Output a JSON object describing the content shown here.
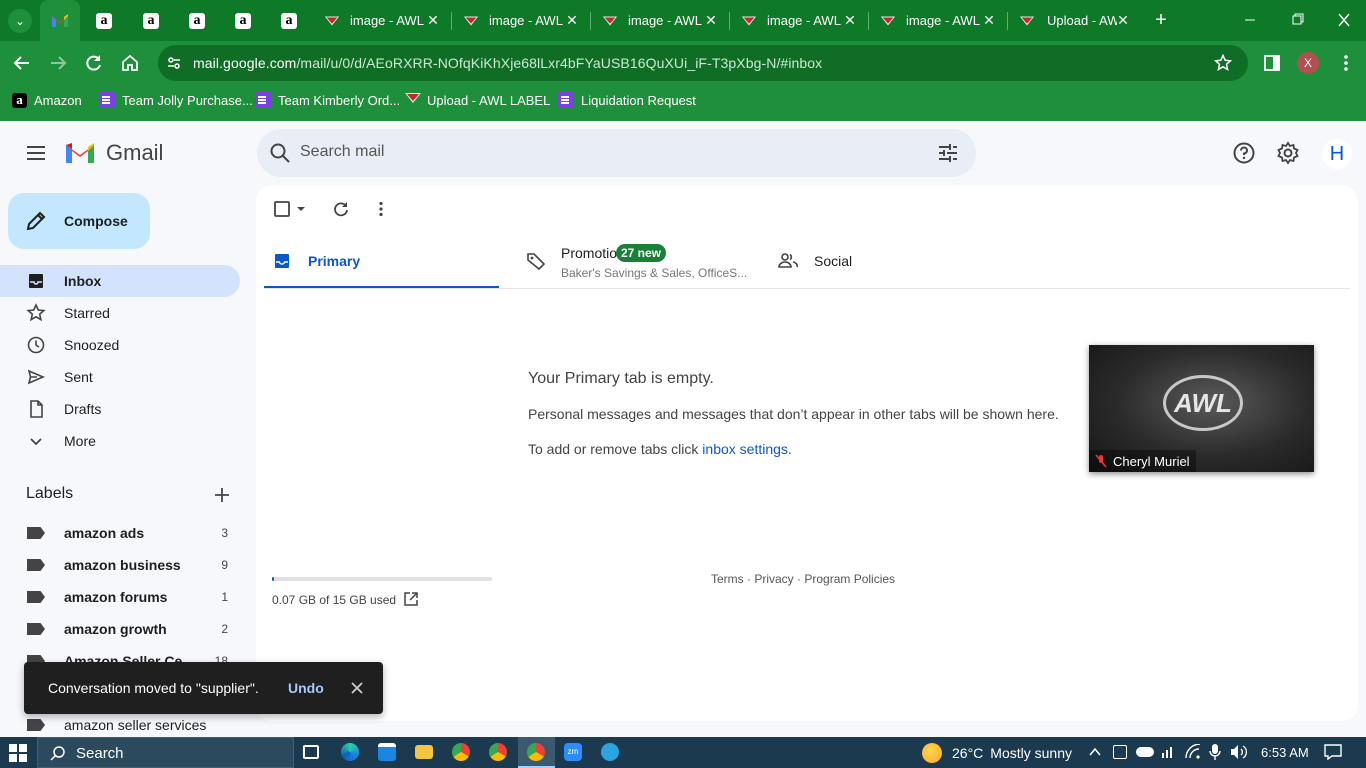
{
  "browser": {
    "tabs": [
      {
        "type": "gmail",
        "title": ""
      },
      {
        "type": "amazon",
        "title": ""
      },
      {
        "type": "amazon",
        "title": ""
      },
      {
        "type": "amazon",
        "title": ""
      },
      {
        "type": "amazon",
        "title": ""
      },
      {
        "type": "amazon",
        "title": ""
      },
      {
        "type": "awl",
        "title": "image - AWL"
      },
      {
        "type": "awl",
        "title": "image - AWL"
      },
      {
        "type": "awl",
        "title": "image - AWL"
      },
      {
        "type": "awl",
        "title": "image - AWL"
      },
      {
        "type": "awl",
        "title": "image - AWL"
      },
      {
        "type": "awl",
        "title": "Upload - AW"
      }
    ],
    "url_host": "mail.google.com",
    "url_path": "/mail/u/0/d/AEoRXRR-NOfqKiKhXje68lLxr4bFYaUSB16QuXUi_iF-T3pXbg-N/#inbox",
    "profile_initial": "X",
    "bookmarks": [
      {
        "icon": "amazon-icon",
        "label": "Amazon"
      },
      {
        "icon": "sheet-icon",
        "label": "Team Jolly Purchase..."
      },
      {
        "icon": "sheet-icon",
        "label": "Team Kimberly Ord..."
      },
      {
        "icon": "awl-icon",
        "label": "Upload - AWL LABEL"
      },
      {
        "icon": "sheet-icon",
        "label": "Liquidation Request"
      }
    ]
  },
  "gmail": {
    "logo_text": "Gmail",
    "search_placeholder": "Search mail",
    "account_initial": "H",
    "compose_label": "Compose",
    "nav": [
      {
        "icon": "inbox-icon",
        "label": "Inbox",
        "active": true
      },
      {
        "icon": "star-icon",
        "label": "Starred"
      },
      {
        "icon": "clock-icon",
        "label": "Snoozed"
      },
      {
        "icon": "send-icon",
        "label": "Sent"
      },
      {
        "icon": "draft-icon",
        "label": "Drafts"
      },
      {
        "icon": "chevron-down-icon",
        "label": "More"
      }
    ],
    "labels_heading": "Labels",
    "labels": [
      {
        "name": "amazon ads",
        "count": "3"
      },
      {
        "name": "amazon business",
        "count": "9"
      },
      {
        "name": "amazon forums",
        "count": "1"
      },
      {
        "name": "amazon growth",
        "count": "2"
      },
      {
        "name": "Amazon Seller Ce...",
        "count": "18"
      },
      {
        "name": "amazon seller services",
        "count": ""
      }
    ],
    "tabs": {
      "primary": "Primary",
      "promotions": "Promotions",
      "promotions_badge": "27 new",
      "promotions_snippet": "Baker's Savings & Sales, OfficeS...",
      "social": "Social"
    },
    "empty": {
      "title": "Your Primary tab is empty.",
      "line1": "Personal messages and messages that don’t appear in other tabs will be shown here.",
      "line2_prefix": "To add or remove tabs click ",
      "line2_link": "inbox settings",
      "line2_suffix": "."
    },
    "storage": {
      "text": "0.07 GB of 15 GB used",
      "fraction": 0.005
    },
    "footer": {
      "terms": "Terms",
      "privacy": "Privacy",
      "policies": "Program Policies",
      "dot": " · "
    },
    "video": {
      "name": "Cheryl Muriel",
      "logo_text": "AWL"
    },
    "snackbar": {
      "message": "Conversation moved to \"supplier\".",
      "action": "Undo"
    }
  },
  "taskbar": {
    "search": "Search",
    "weather_temp": "26°C",
    "weather_text": "Mostly sunny",
    "time": "6:53 AM"
  },
  "colors": {
    "chrome_dark": "#0e7a28",
    "chrome": "#1e8f3a",
    "badge": "#188038",
    "link": "#0b57d0",
    "accent": "#0b57d0"
  }
}
